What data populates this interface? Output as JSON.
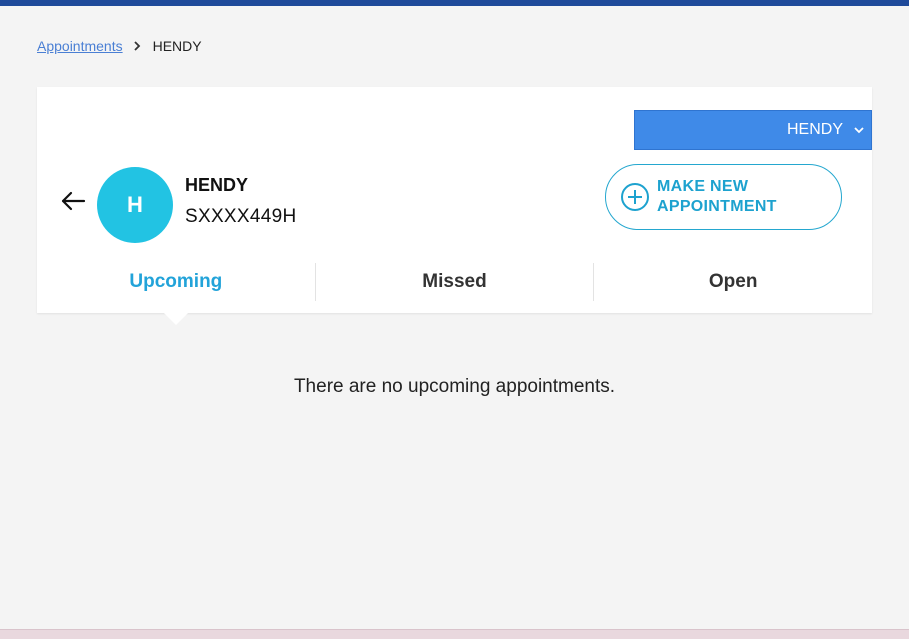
{
  "breadcrumb": {
    "parent_label": "Appointments",
    "current_label": "HENDY"
  },
  "selector": {
    "selected": "HENDY"
  },
  "patient": {
    "initial": "H",
    "name": "HENDY",
    "id": "SXXXX449H"
  },
  "actions": {
    "make_appointment_label": "MAKE NEW\nAPPOINTMENT"
  },
  "tabs": [
    {
      "label": "Upcoming",
      "active": true
    },
    {
      "label": "Missed",
      "active": false
    },
    {
      "label": "Open",
      "active": false
    }
  ],
  "empty_state": {
    "message": "There are no upcoming appointments."
  },
  "colors": {
    "header_bar": "#1f4a9a",
    "accent": "#22a3d9",
    "avatar": "#22c3e3",
    "selector": "#3f8ae8"
  },
  "icons": {
    "breadcrumb_separator": "chevron-right-icon",
    "selector_caret": "chevron-down-icon",
    "back": "arrow-left-icon",
    "add": "plus-circle-icon"
  }
}
